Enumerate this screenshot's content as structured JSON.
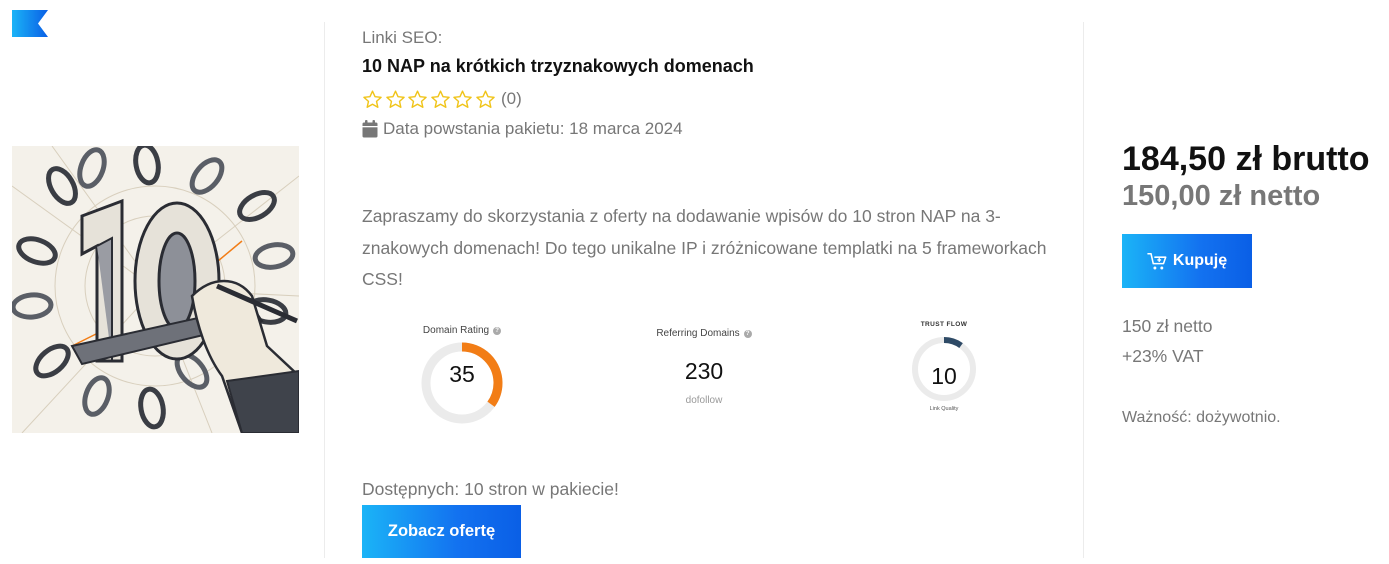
{
  "brand": {
    "accent": "#0f7bef",
    "gradient_start": "#1bb4f7",
    "gradient_end": "#0a5fe6",
    "star_color": "#f0c419",
    "gauge_orange": "#f27d16",
    "gauge_navy": "#2e4a66"
  },
  "product": {
    "category": "Linki SEO:",
    "title": "10 NAP na krótkich trzyznakowych domenach",
    "rating": {
      "stars": 6,
      "filled": 0,
      "count_text": "(0)"
    },
    "created_text": "Data powstania pakietu: 18 marca 2024",
    "description": "Zapraszamy do skorzystania z oferty na dodawanie wpisów do 10 stron NAP na 3-znakowych domenach! Do tego unikalne IP i zróżnicowane templatki na 5 frameworkach CSS!",
    "image": {
      "subject": "hand-drawn number 10 with chain links illustration"
    }
  },
  "metrics": {
    "domain_rating": {
      "label": "Domain Rating",
      "help_icon": "question-icon",
      "value": "35",
      "fraction": 0.35
    },
    "referring_domains": {
      "label": "Referring Domains",
      "help_icon": "question-icon",
      "value": "230",
      "sublabel": "dofollow"
    },
    "trust_flow": {
      "title": "TRUST FLOW",
      "value": "10",
      "fraction": 0.1,
      "sublabel": "Link Quality"
    }
  },
  "availability": {
    "text": "Dostępnych: 10 stron w pakiecie!"
  },
  "buttons": {
    "offer_label": "Zobacz ofertę",
    "buy_label": "Kupuję",
    "buy_icon": "cart-icon"
  },
  "pricing": {
    "gross": "184,50 zł brutto",
    "net": "150,00 zł netto",
    "net_small": "150 zł netto",
    "vat": "+23% VAT",
    "validity": "Ważność: dożywotnio."
  }
}
